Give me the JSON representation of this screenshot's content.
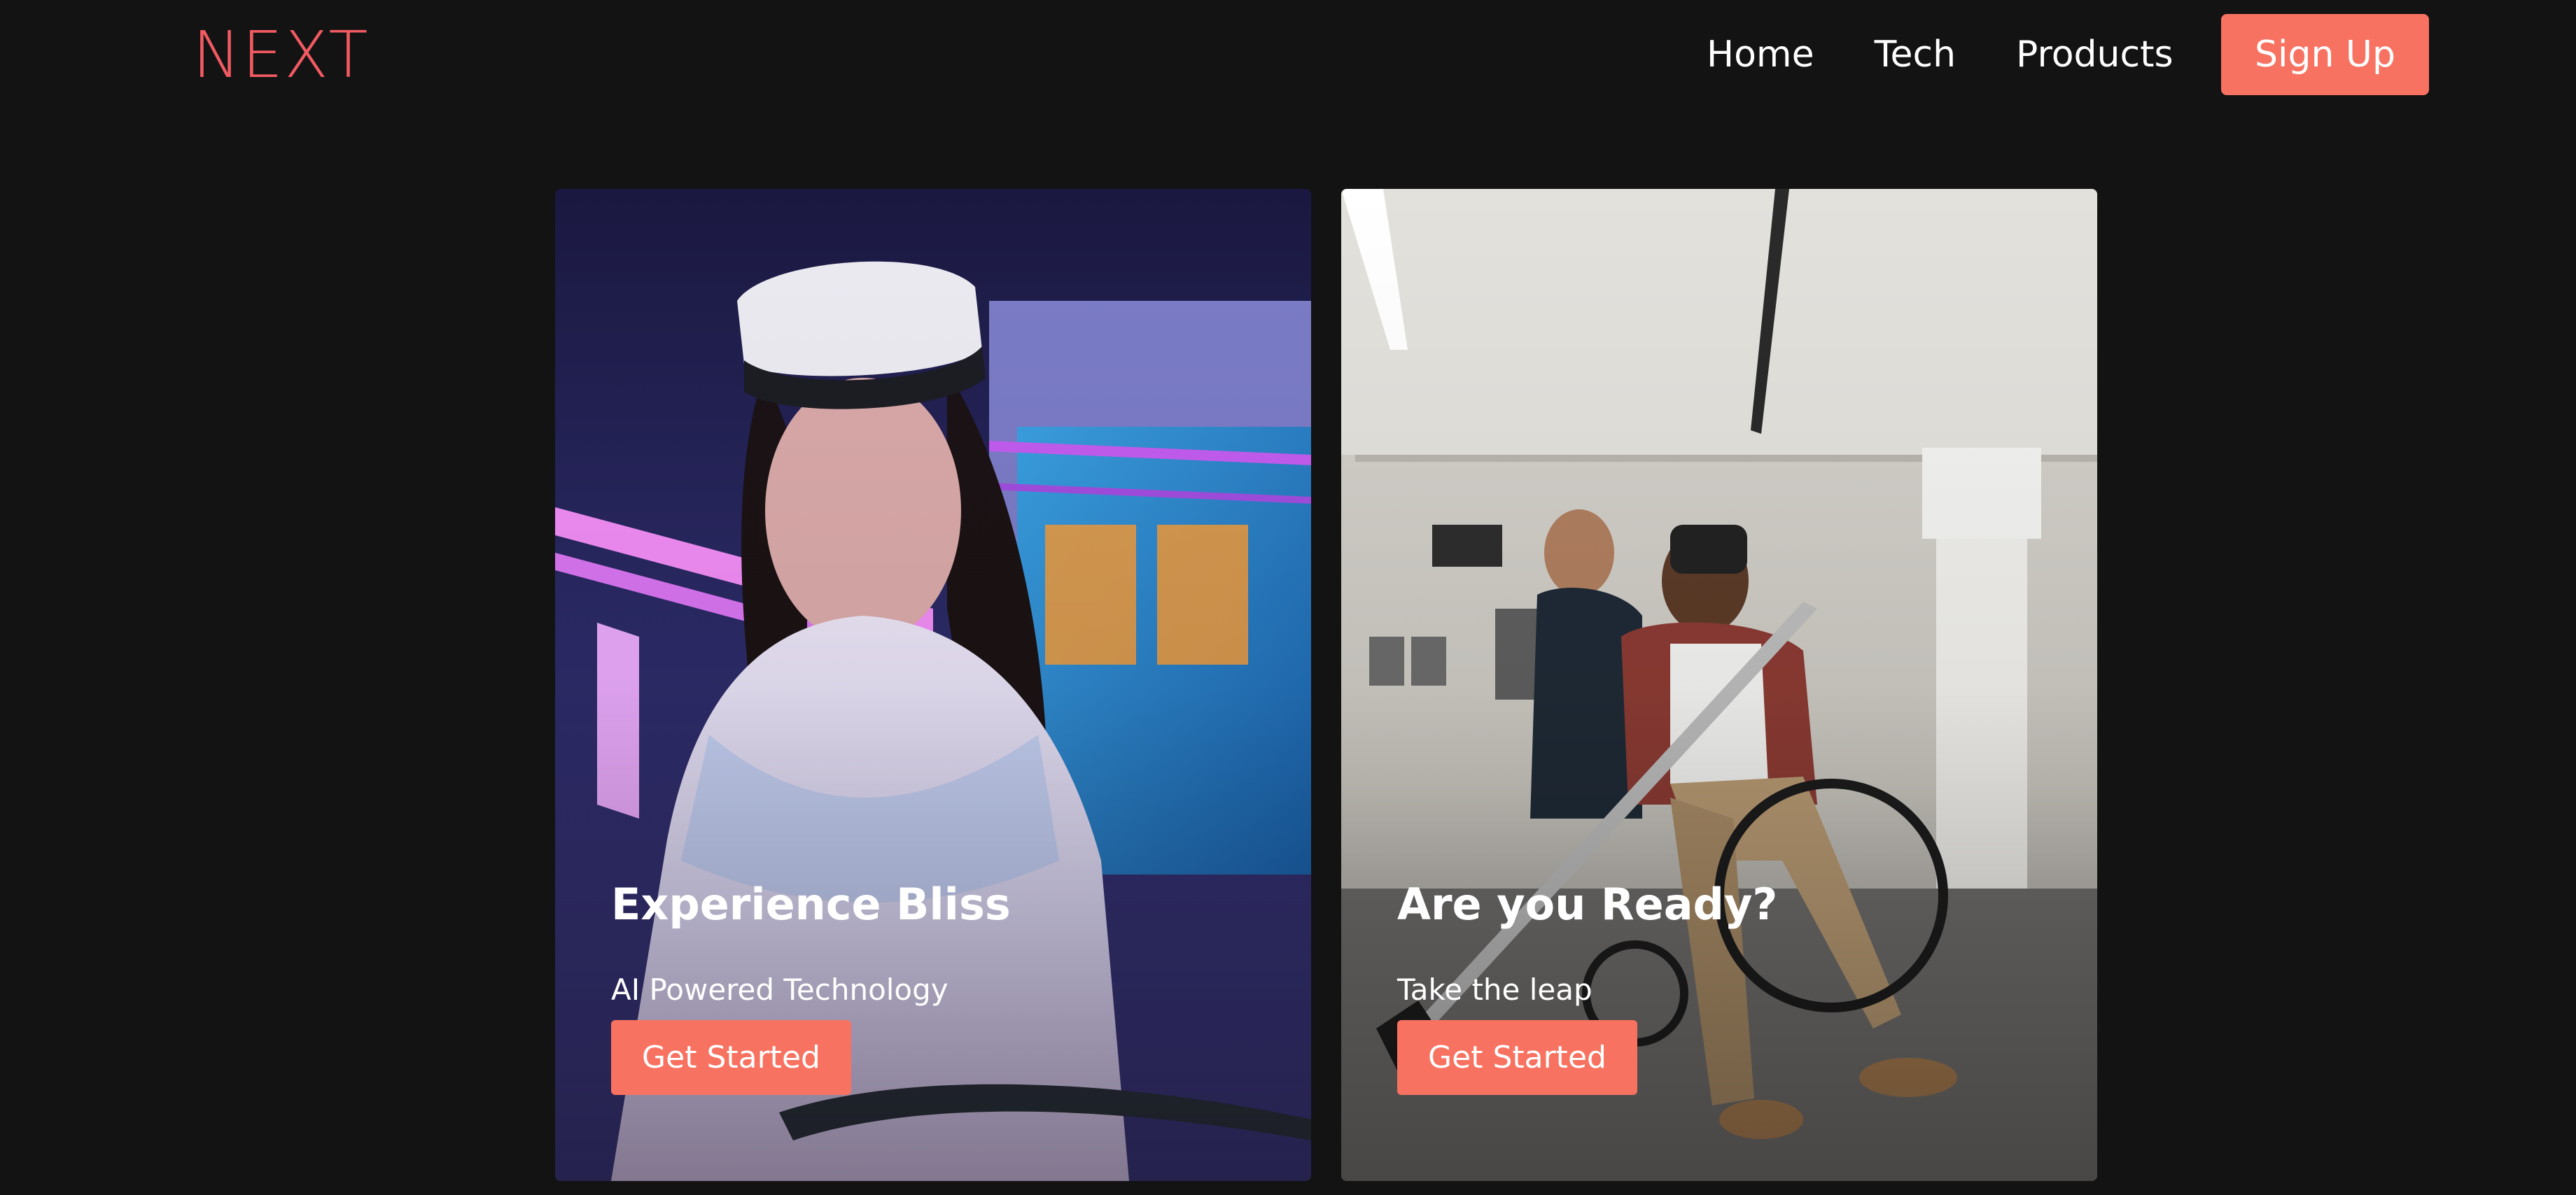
{
  "brand": {
    "logo_text": "NEXT",
    "accent_color": "#f25a62",
    "button_color": "#f87261",
    "background_color": "#131313"
  },
  "nav": {
    "items": [
      {
        "label": "Home"
      },
      {
        "label": "Tech"
      },
      {
        "label": "Products"
      }
    ],
    "signup_label": "Sign Up"
  },
  "cards": [
    {
      "title": "Experience Bliss",
      "subtitle": "AI Powered Technology",
      "button_label": "Get Started",
      "image_description_icon": "vr-headset-woman-photo"
    },
    {
      "title": "Are you Ready?",
      "subtitle": "Take the leap",
      "button_label": "Get Started",
      "image_description_icon": "vr-wheelchair-man-photo"
    }
  ]
}
